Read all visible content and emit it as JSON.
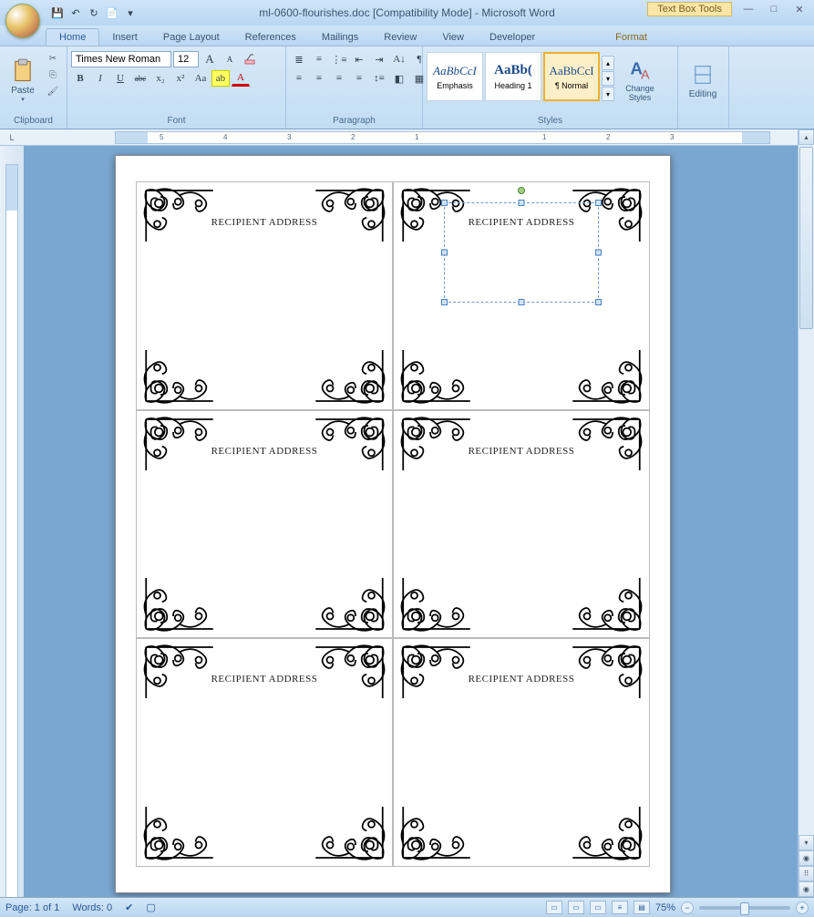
{
  "window": {
    "title": "ml-0600-flourishes.doc [Compatibility Mode] - Microsoft Word",
    "context_tools_title": "Text Box Tools"
  },
  "qat": {
    "save": "💾",
    "undo": "↶",
    "redo": "↻",
    "quickprint": "📄"
  },
  "tabs": {
    "home": "Home",
    "insert": "Insert",
    "page_layout": "Page Layout",
    "references": "References",
    "mailings": "Mailings",
    "review": "Review",
    "view": "View",
    "developer": "Developer",
    "format": "Format"
  },
  "ribbon": {
    "clipboard": {
      "label": "Clipboard",
      "paste": "Paste"
    },
    "font": {
      "label": "Font",
      "family": "Times New Roman",
      "size": "12",
      "bold": "B",
      "italic": "I",
      "underline": "U",
      "strike": "abc",
      "sub": "x₂",
      "sup": "x²",
      "case": "Aa",
      "grow": "A",
      "shrink": "A",
      "clear": "⌫"
    },
    "paragraph": {
      "label": "Paragraph"
    },
    "styles": {
      "label": "Styles",
      "items": [
        {
          "preview": "AaBbCcI",
          "name": "Emphasis"
        },
        {
          "preview": "AaBb(",
          "name": "Heading 1"
        },
        {
          "preview": "AaBbCcI",
          "name": "¶ Normal"
        }
      ],
      "change_styles": "Change Styles"
    },
    "editing": {
      "label": "Editing"
    }
  },
  "ruler": {
    "marks": [
      "5",
      "4",
      "3",
      "2",
      "1",
      "",
      "1",
      "2",
      "3"
    ]
  },
  "document": {
    "labels": [
      {
        "text": "RECIPIENT ADDRESS",
        "selected": false
      },
      {
        "text": "RECIPIENT ADDRESS",
        "selected": true
      },
      {
        "text": "RECIPIENT ADDRESS",
        "selected": false
      },
      {
        "text": "RECIPIENT ADDRESS",
        "selected": false
      },
      {
        "text": "RECIPIENT ADDRESS",
        "selected": false
      },
      {
        "text": "RECIPIENT ADDRESS",
        "selected": false
      }
    ]
  },
  "status": {
    "page": "Page: 1 of 1",
    "words": "Words: 0",
    "zoom": "75%"
  }
}
